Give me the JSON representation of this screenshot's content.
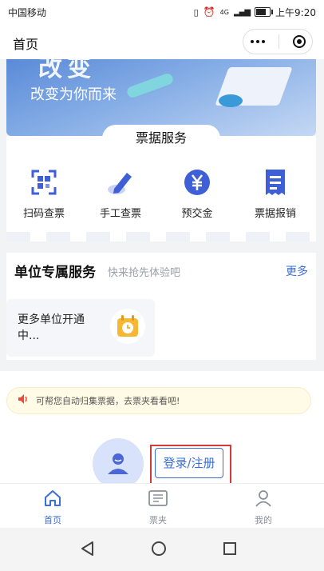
{
  "status_bar": {
    "carrier": "中国移动",
    "network": "4G",
    "time": "上午9:20"
  },
  "nav": {
    "title": "首页"
  },
  "banner": {
    "headline": "改变",
    "subtitle": "改变为你而来"
  },
  "ticket_service": {
    "title": "票据服务",
    "items": [
      {
        "label": "扫码查票",
        "icon": "scan-icon"
      },
      {
        "label": "手工查票",
        "icon": "pen-icon"
      },
      {
        "label": "预交金",
        "icon": "yuan-icon"
      },
      {
        "label": "票据报销",
        "icon": "receipt-icon"
      }
    ]
  },
  "unit_service": {
    "title": "单位专属服务",
    "subtitle": "快来抢先体验吧",
    "more": "更多",
    "card_text": "更多单位开通中...",
    "card_icon": "calendar-icon"
  },
  "notice": {
    "text": "可帮您自动归集票据，去票夹看看吧!",
    "icon": "speaker-icon"
  },
  "login": {
    "button": "登录/注册",
    "avatar_icon": "user-avatar-icon"
  },
  "tabs": [
    {
      "label": "首页",
      "icon": "home-icon",
      "active": true
    },
    {
      "label": "票夹",
      "icon": "ticket-folder-icon",
      "active": false
    },
    {
      "label": "我的",
      "icon": "person-icon",
      "active": false
    }
  ],
  "colors": {
    "accent": "#3a6fd8",
    "icon_blue": "#3f5fd6",
    "highlight_border": "#d43a3a",
    "notice_bg": "#fffbe6"
  }
}
